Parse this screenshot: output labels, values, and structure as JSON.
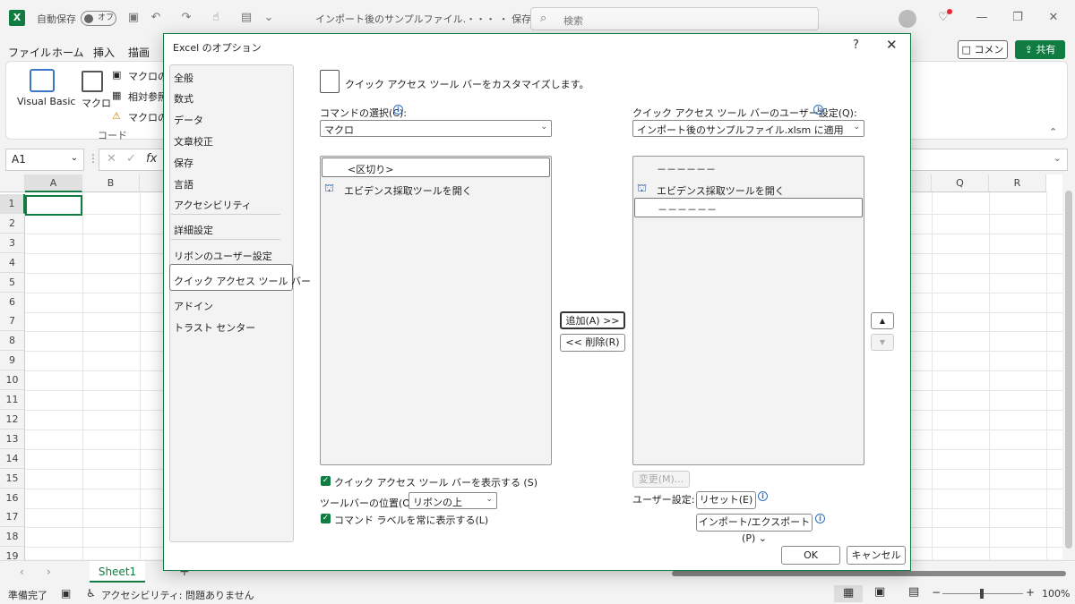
{
  "titlebar": {
    "autosave_label": "自動保存",
    "autosave_state": "オフ",
    "doc_title": "インポート後のサンプルファイル.・・・ ・ 保存済み ⌄",
    "search_placeholder": "検索"
  },
  "ribbon": {
    "tabs": [
      "ファイル",
      "ホーム",
      "挿入",
      "描画"
    ],
    "comment_label": "コメント",
    "share_label": "共有",
    "visual_basic": "Visual Basic",
    "macro": "マクロ",
    "record_macro": "マクロの記",
    "relative_ref": "相対参照",
    "macro_security": "マクロのセ",
    "group_label": "コード"
  },
  "formula_bar": {
    "name_box": "A1",
    "fx": "fx"
  },
  "grid": {
    "columns": [
      "A",
      "B",
      "Q",
      "R"
    ],
    "rows": [
      "1",
      "2",
      "3",
      "4",
      "5",
      "6",
      "7",
      "8",
      "9",
      "10",
      "11",
      "12",
      "13",
      "14",
      "15",
      "16",
      "17",
      "18",
      "19"
    ]
  },
  "sheet_tabs": {
    "active": "Sheet1"
  },
  "statusbar": {
    "ready": "準備完了",
    "accessibility": "アクセシビリティ: 問題ありません",
    "zoom": "100%"
  },
  "dialog": {
    "title": "Excel のオプション",
    "help": "?",
    "close": "✕",
    "nav_items": [
      "全般",
      "数式",
      "データ",
      "文章校正",
      "保存",
      "言語",
      "アクセシビリティ",
      "詳細設定",
      "リボンのユーザー設定",
      "クイック アクセス ツール バー",
      "アドイン",
      "トラスト センター"
    ],
    "selected_nav": "クイック アクセス ツール バー",
    "heading": "クイック アクセス ツール バーをカスタマイズします。",
    "choose_label": "コマンドの選択(C):",
    "choose_value": "マクロ",
    "left_list": [
      "<区切り>",
      "エビデンス採取ツールを開く"
    ],
    "customize_label": "クイック アクセス ツール バーのユーザー設定(Q):",
    "customize_value": "インポート後のサンプルファイル.xlsm に適用",
    "right_list": [
      "－－－－－－",
      "エビデンス採取ツールを開く",
      "－－－－－－"
    ],
    "add_btn": "追加(A) >>",
    "remove_btn": "<< 削除(R)",
    "up_btn": "▲",
    "down_btn": "▼",
    "show_qat": "クイック アクセス ツール バーを表示する (S)",
    "toolbar_pos_label": "ツールバーの位置(O)",
    "toolbar_pos_value": "リボンの上",
    "always_label": "コマンド ラベルを常に表示する(L)",
    "modify_btn": "変更(M)...",
    "customizations_label": "ユーザー設定:",
    "reset_btn": "リセット(E) ⌄",
    "import_export_btn": "インポート/エクスポート(P) ⌄",
    "ok_btn": "OK",
    "cancel_btn": "キャンセル"
  },
  "colors": {
    "excel_green": "#107c41",
    "info_blue": "#2f6fbd"
  }
}
